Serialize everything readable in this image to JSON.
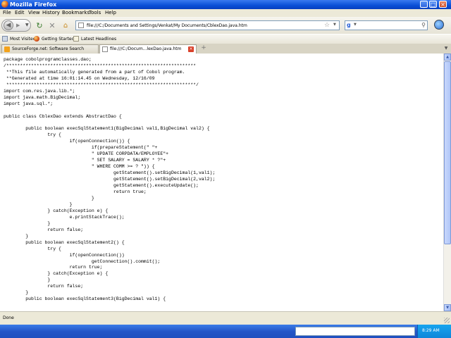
{
  "window": {
    "title": "Mozilla Firefox"
  },
  "menu": [
    "File",
    "Edit",
    "View",
    "History",
    "Bookmarks",
    "Tools",
    "Help"
  ],
  "nav": {
    "url": "file:///C:/Documents and Settings/Venkat/My Documents/CblexDao.java.htm",
    "search_value": ""
  },
  "bookmarks": [
    "Most Visited",
    "Getting Started",
    "Latest Headlines"
  ],
  "tabs": [
    {
      "label": "SourceForge.net: Software Search",
      "active": false
    },
    {
      "label": "file:///C:/Docum...lexDao.java.htm",
      "active": true
    }
  ],
  "code_lines": [
    "package cobolprogramclasses.dao;",
    "/*********************************************************************",
    " **This file automatically generated from a part of Cobol program.",
    " **Generated at time 16:01:14.45 on Wednesday, 12/16/09",
    " *********************************************************************/",
    "import com.res.java.lib.*;",
    "import java.math.BigDecimal;",
    "import java.sql.*;",
    "",
    "public class CblexDao extends AbstractDao {",
    "",
    "        public boolean execSqlStatement1(BigDecimal val1,BigDecimal val2) {",
    "                try {",
    "                        if(openConnection()) {",
    "                                if(prepareStatement(\" \"+",
    "                                \" UPDATE CORPDATA/EMPLOYEE\"+",
    "                                \" SET SALARY = SALARY * ?\"+",
    "                                \" WHERE COMM >= ? \")) {",
    "                                        getStatement().setBigDecimal(1,val1);",
    "                                        getStatement().setBigDecimal(2,val2);",
    "                                        getStatement().executeUpdate();",
    "                                        return true;",
    "                                }",
    "                        }",
    "                } catch(Exception e) {",
    "                        e.printStackTrace();",
    "                }",
    "                return false;",
    "        }",
    "        public boolean execSqlStatement2() {",
    "                try {",
    "                        if(openConnection())",
    "                                getConnection().commit();",
    "                        return true;",
    "                } catch(Exception e) {",
    "                }",
    "                return false;",
    "        }",
    "        public boolean execSqlStatement3(BigDecimal val1) {"
  ],
  "status": {
    "text": "Done"
  },
  "taskbar": {
    "clock": "8:29 AM"
  },
  "colors": {
    "title_bar": "#0a4fd6",
    "taskbar": "#2456c8",
    "tray": "#0f86d9",
    "tab_close": "#d9402a"
  }
}
